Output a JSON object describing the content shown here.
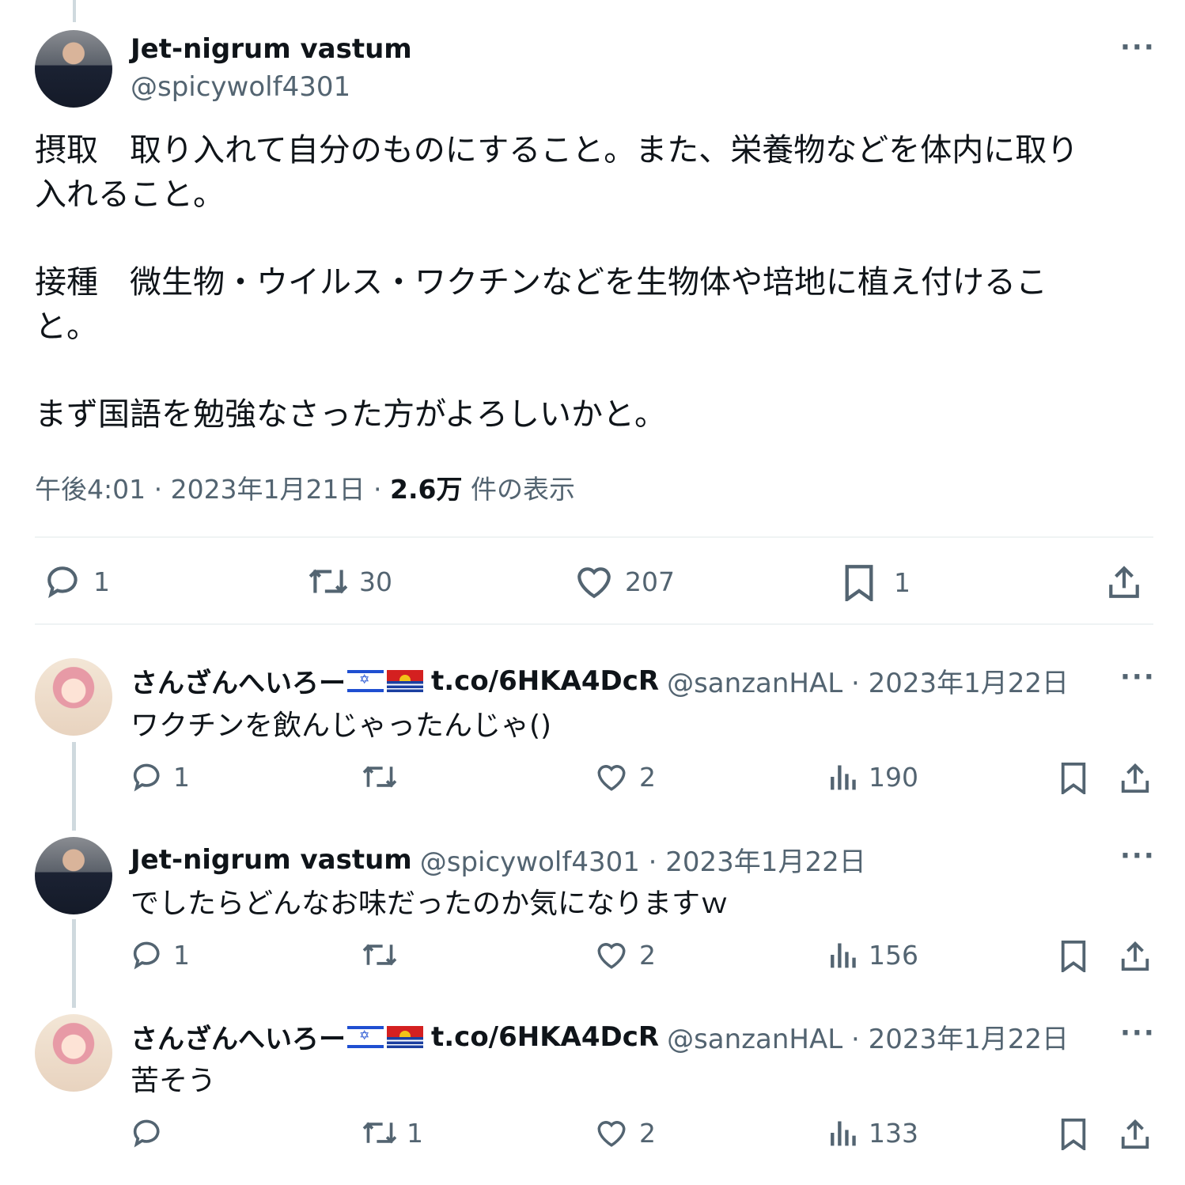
{
  "main_tweet": {
    "author_name": "Jet-nigrum vastum",
    "author_handle": "@spicywolf4301",
    "text_lines": [
      "摂取　取り入れて自分のものにすること。また、栄養物などを体内に取り",
      "入れること。",
      "接種　微生物・ウイルス・ワクチンなどを生物体や培地に植え付けるこ",
      "と。",
      "まず国語を勉強なさった方がよろしいかと。"
    ],
    "time": "午後4:01 · 2023年1月21日 · ",
    "views_count": "2.6万",
    "views_label": " 件の表示",
    "actions": {
      "replies": "1",
      "retweets": "30",
      "likes": "207",
      "bookmarks": "1"
    },
    "more_label": "···"
  },
  "replies": [
    {
      "author_name": "さんざんへいろー",
      "author_link": "t.co/6HKA4DcR",
      "author_handle": "@sanzanHAL · 2023年1月22日",
      "text": "ワクチンを飲んじゃったんじゃ()",
      "actions": {
        "replies": "1",
        "retweets": "",
        "likes": "2",
        "views": "190"
      },
      "flags": [
        "israel-flag",
        "kiribati-flag"
      ]
    },
    {
      "author_name": "Jet-nigrum vastum",
      "author_link": "",
      "author_handle": "@spicywolf4301 · 2023年1月22日",
      "text": "でしたらどんなお味だったのか気になりますｗ",
      "actions": {
        "replies": "1",
        "retweets": "",
        "likes": "2",
        "views": "156"
      },
      "flags": []
    },
    {
      "author_name": "さんざんへいろー",
      "author_link": "t.co/6HKA4DcR",
      "author_handle": "@sanzanHAL · 2023年1月22日",
      "text": "苦そう",
      "actions": {
        "replies": "",
        "retweets": "1",
        "likes": "2",
        "views": "133"
      },
      "flags": [
        "israel-flag",
        "kiribati-flag"
      ]
    }
  ],
  "icons": [
    "reply-icon",
    "retweet-icon",
    "like-icon",
    "bookmark-icon",
    "share-icon",
    "views-icon",
    "more-icon"
  ],
  "colors": {
    "text": "#0f1419",
    "secondary": "#536471",
    "divider": "#eff3f4",
    "thread_line": "#cfd9de"
  }
}
